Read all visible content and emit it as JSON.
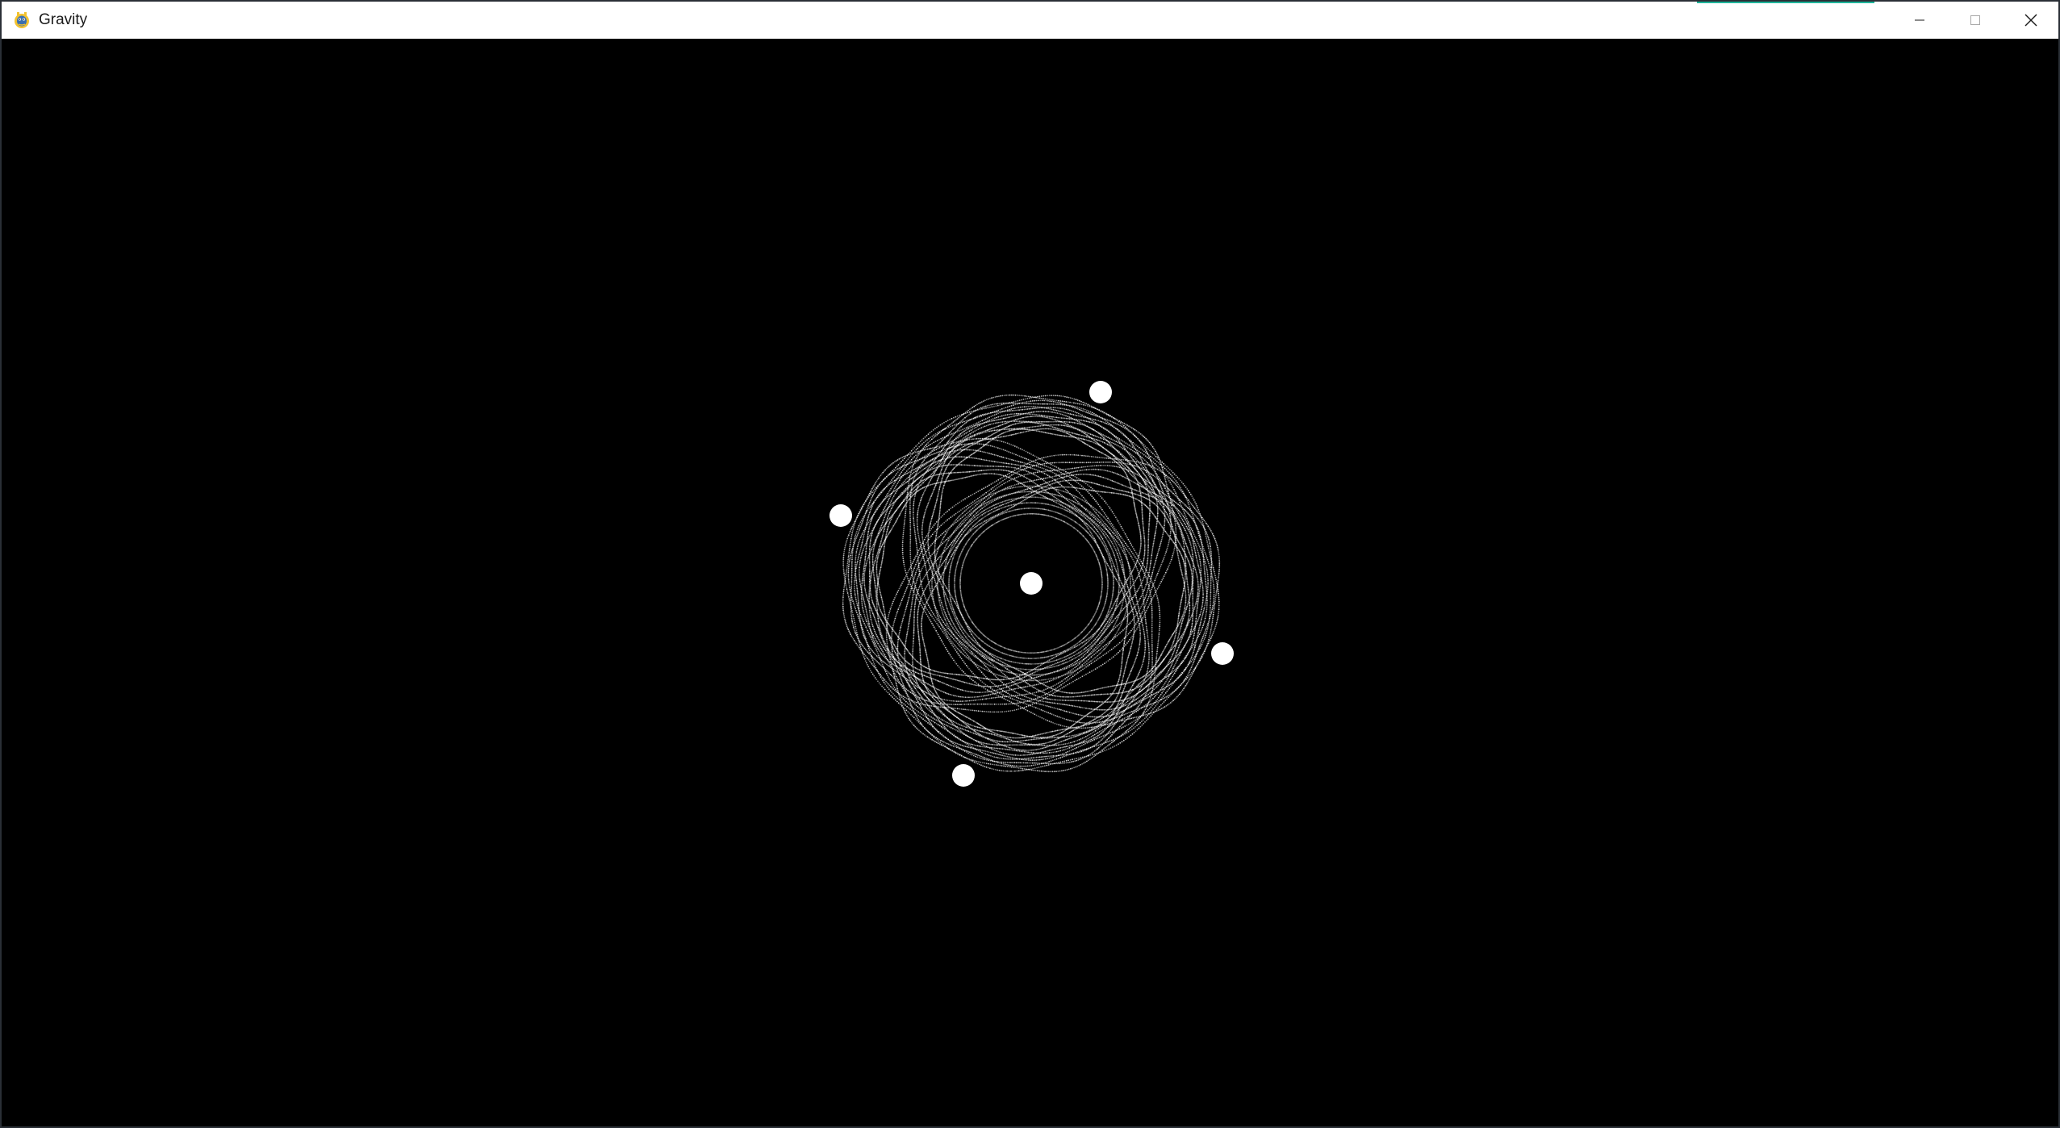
{
  "window": {
    "title": "Gravity",
    "app_icon": "pygame-snake-icon",
    "controls": {
      "minimize_icon": "minimize-icon",
      "maximize_icon": "maximize-icon",
      "close_icon": "close-icon"
    },
    "accent_color": "#1fb59a"
  },
  "simulation": {
    "background_color": "#000000",
    "particle_color": "#ffffff",
    "bodies": [
      {
        "name": "central-body"
      },
      {
        "name": "orbiting-body-1"
      },
      {
        "name": "orbiting-body-2"
      },
      {
        "name": "orbiting-body-3"
      },
      {
        "name": "orbiting-body-4"
      }
    ]
  }
}
